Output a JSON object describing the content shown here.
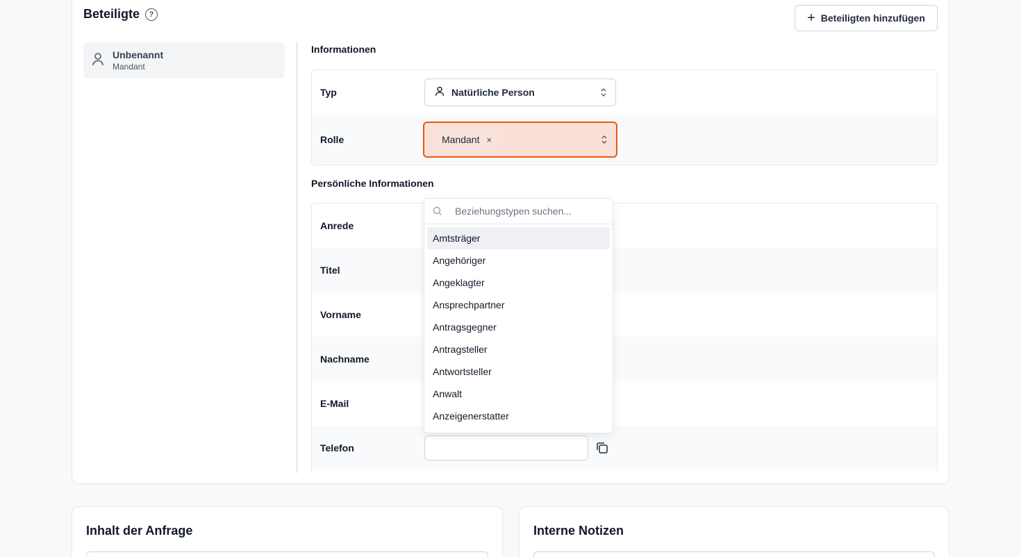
{
  "participants": {
    "title": "Beteiligte",
    "add_button": "Beteiligten hinzufügen",
    "items": [
      {
        "name": "Unbenannt",
        "role": "Mandant"
      }
    ]
  },
  "info": {
    "title": "Informationen",
    "typ_label": "Typ",
    "typ_value": "Natürliche Person",
    "rolle_label": "Rolle",
    "rolle_chip": "Mandant",
    "chip_remove": "×"
  },
  "personal": {
    "title": "Persönliche Informationen",
    "fields": [
      "Anrede",
      "Titel",
      "Vorname",
      "Nachname",
      "E-Mail",
      "Telefon"
    ]
  },
  "dropdown": {
    "placeholder": "Beziehungstypen suchen...",
    "options": [
      "Amtsträger",
      "Angehöriger",
      "Angeklagter",
      "Ansprechpartner",
      "Antragsgegner",
      "Antragsteller",
      "Antwortsteller",
      "Anwalt",
      "Anzeigenerstatter"
    ],
    "highlighted": "Amtsträger"
  },
  "bottom": {
    "request_title": "Inhalt der Anfrage",
    "notes_title": "Interne Notizen"
  },
  "colors": {
    "error_border": "#ea580c",
    "error_bg": "#fbe0d7"
  }
}
